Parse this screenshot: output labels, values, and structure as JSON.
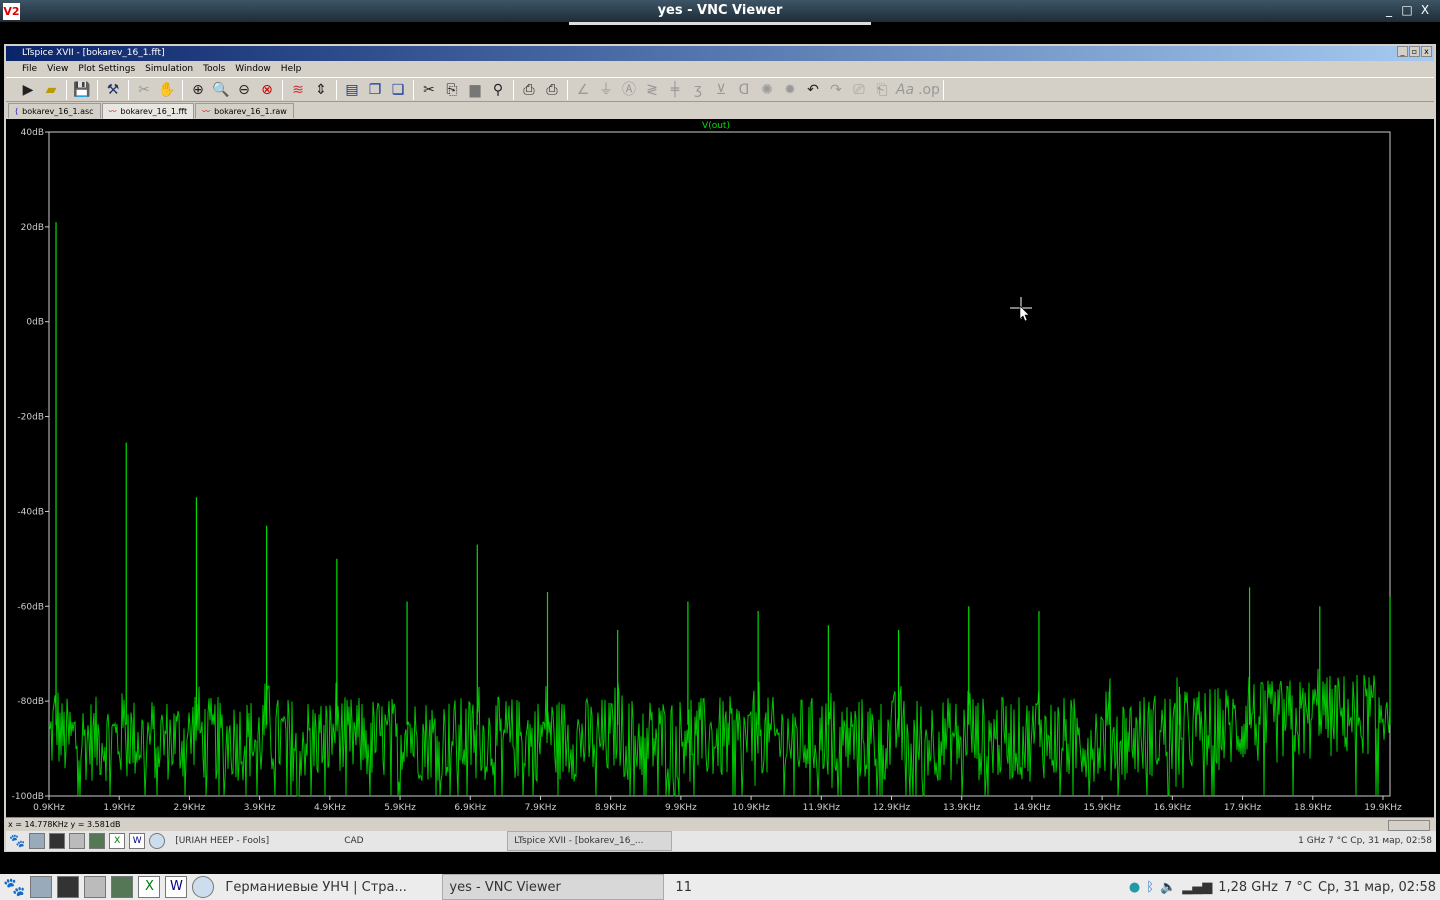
{
  "vnc": {
    "title": "yes - VNC Viewer",
    "logo": "V2",
    "minimize": "_",
    "maximize": "□",
    "close": "X"
  },
  "ltspice": {
    "title": "LTspice XVII - [bokarev_16_1.fft]",
    "menu": [
      "File",
      "View",
      "Plot Settings",
      "Simulation",
      "Tools",
      "Window",
      "Help"
    ],
    "toolbar": [
      "run-icon",
      "open-icon",
      "save-icon",
      "control-panel-icon",
      "halt-icon",
      "hand-icon",
      "zoom-in-icon",
      "zoom-fit-icon",
      "zoom-out-icon",
      "zoom-cancel-icon",
      "autorange-icon",
      "manual-limits-icon",
      "tile-icon",
      "cascade-icon",
      "arrange-icon",
      "cut-icon",
      "copy-icon",
      "paste-icon",
      "find-icon",
      "print-preview-icon",
      "print-icon",
      "wire-icon",
      "ground-icon",
      "label-icon",
      "resistor-icon",
      "capacitor-icon",
      "inductor-icon",
      "diode-icon",
      "component-icon",
      "rotate-icon",
      "mirror-icon",
      "undo-icon",
      "redo-icon",
      "move-icon",
      "drag-icon",
      "text-icon",
      "spice-directive-icon"
    ],
    "tabs": [
      {
        "label": "bokarev_16_1.asc"
      },
      {
        "label": "bokarev_16_1.fft",
        "active": true
      },
      {
        "label": "bokarev_16_1.raw"
      }
    ],
    "status": "x = 14.778KHz    y = 3.581dB"
  },
  "chart_data": {
    "type": "line",
    "title": "V(out)",
    "xlabel": "",
    "ylabel": "",
    "xlim": [
      0.9,
      20.0
    ],
    "ylim": [
      -100,
      40
    ],
    "x_ticks": [
      "0.9KHz",
      "1.9KHz",
      "2.9KHz",
      "3.9KHz",
      "4.9KHz",
      "5.9KHz",
      "6.9KHz",
      "7.9KHz",
      "8.9KHz",
      "9.9KHz",
      "10.9KHz",
      "11.9KHz",
      "12.9KHz",
      "13.9KHz",
      "14.9KHz",
      "15.9KHz",
      "16.9KHz",
      "17.9KHz",
      "18.9KHz",
      "19.9KHz"
    ],
    "y_ticks": [
      "40dB",
      "20dB",
      "0dB",
      "-20dB",
      "-40dB",
      "-60dB",
      "-80dB",
      "-100dB"
    ],
    "grid": false,
    "color": "#00e000",
    "x_unit": "kHz",
    "y_unit": "dB",
    "peaks": {
      "x": [
        1,
        2,
        3,
        4,
        5,
        6,
        7,
        8,
        9,
        10,
        11,
        12,
        13,
        14,
        15,
        16,
        17,
        18,
        19,
        20
      ],
      "y": [
        21,
        -25.5,
        -37,
        -43,
        -50,
        -59,
        -47,
        -57,
        -65,
        -59,
        -61,
        -64,
        -65,
        -60,
        -61,
        -78,
        -77,
        -56,
        -60,
        -58
      ]
    },
    "noise_floor_db": [
      -100,
      -80
    ]
  },
  "inner_taskbar": {
    "tasks": [
      "[URIAH HEEP - Fools]",
      "CAD",
      "LTspice XVII - [bokarev_16_..."
    ],
    "tray": "1   GHz   7 °C   Ср, 31 мар, 02:58"
  },
  "outer_taskbar": {
    "tasks": [
      "Германиевые УНЧ | Стра...",
      "yes - VNC Viewer",
      "11"
    ],
    "cpu": "1,28 GHz",
    "temp": "7 °C",
    "clock": "Ср, 31 мар, 02:58"
  }
}
